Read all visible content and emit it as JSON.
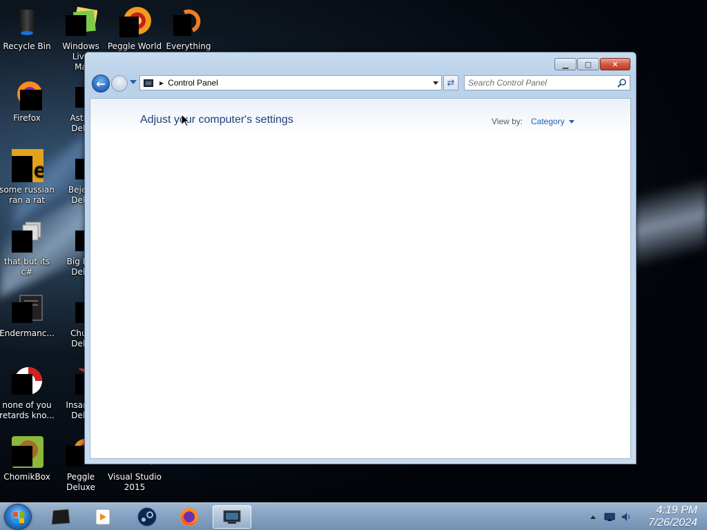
{
  "desktop": {
    "icons": [
      {
        "label": "Recycle Bin"
      },
      {
        "label": "Windows Live\nMa"
      },
      {
        "label": "Peggle World"
      },
      {
        "label": "Everything"
      },
      {
        "label": "Firefox"
      },
      {
        "label": "Astro\nDelu"
      },
      {
        "label": "some russian\nran a rat"
      },
      {
        "label": "Bejew\nDelu"
      },
      {
        "label": "that but its c#"
      },
      {
        "label": "Big Mo\nDelu"
      },
      {
        "label": "Endermanc..."
      },
      {
        "label": "Chuz\nDelu"
      },
      {
        "label": "none of you\nretards kno..."
      },
      {
        "label": "Insaniq\nDelu"
      },
      {
        "label": "ChomikBox"
      },
      {
        "label": "Peggle Deluxe"
      },
      {
        "label": "Visual Studio\n2015"
      }
    ]
  },
  "window": {
    "controls": {
      "minimize": "▁",
      "maximize": "▢",
      "close": "✕"
    },
    "address": {
      "crumb": "Control Panel"
    },
    "search": {
      "placeholder": "Search Control Panel"
    },
    "content": {
      "title": "Adjust your computer's settings",
      "view_by_label": "View by:",
      "view_by_value": "Category"
    }
  },
  "taskbar": {
    "time": "4:19 PM",
    "date": "7/26/2024",
    "pinned": [
      "cmd-window-icon",
      "media-player-icon",
      "steam-icon",
      "firefox-icon",
      "control-panel-icon"
    ]
  },
  "colors": {
    "title_blue": "#1e3f7a",
    "link_blue": "#1e5fb4",
    "taskbar": "#86a3c2"
  }
}
